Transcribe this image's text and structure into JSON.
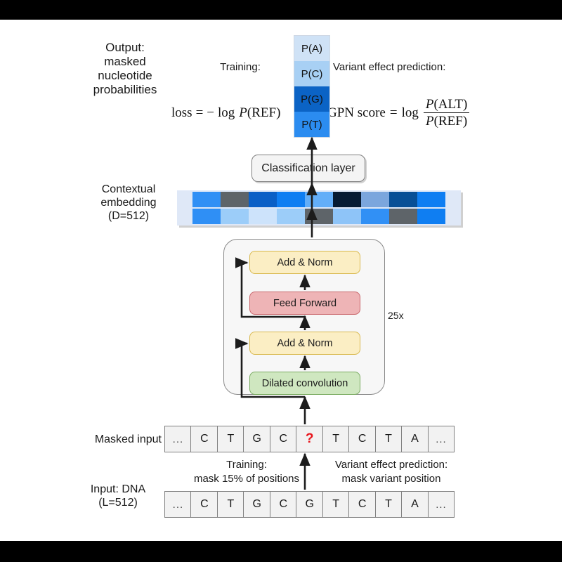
{
  "figure": {
    "left_labels": {
      "output": "Output:\nmasked\nnucleotide\nprobabilities",
      "contextual_embedding": "Contextual\nembedding\n(D=512)",
      "masked_input": "Masked input",
      "input_dna": "Input: DNA\n(L=512)"
    },
    "top_section": {
      "training_heading": "Training:",
      "loss_formula": "loss = − log P(REF)",
      "loss_parts": {
        "lhs": "loss",
        "eq": "=",
        "minus": "−",
        "log": "log",
        "p_italic": "P",
        "ref_arg": "(REF)"
      },
      "variant_heading": "Variant effect prediction:",
      "gpn_formula": "GPN score = log P(ALT)/P(REF)",
      "gpn_parts": {
        "lhs": "GPN score",
        "eq": "=",
        "log": "log",
        "numerator_p": "P",
        "numerator_arg": "(ALT)",
        "denominator_p": "P",
        "denominator_arg": "(REF)"
      }
    },
    "probability_column": {
      "name": "masked-nucleotide-probabilities",
      "cells": [
        {
          "label": "P(A)",
          "color": "#cfe2f6"
        },
        {
          "label": "P(C)",
          "color": "#a8d0f4"
        },
        {
          "label": "P(G)",
          "color": "#0b63c5"
        },
        {
          "label": "P(T)",
          "color": "#2b8cf0"
        }
      ]
    },
    "classification_layer": {
      "label": "Classification layer"
    },
    "embedding_strip": {
      "pad_color": "#dfe8f7",
      "row_top": [
        "#3190f5",
        "#5e6469",
        "#0a5fc6",
        "#0f7ef2",
        "#63aef8",
        "#061b33",
        "#7ba6dd",
        "#084f96",
        "#0f7ef2"
      ],
      "row_bottom": [
        "#2f8ff5",
        "#9ccdf9",
        "#cde3fb",
        "#9ccdf9",
        "#5e6469",
        "#8ec4f8",
        "#3190f5",
        "#5e6469",
        "#0f7ef2"
      ]
    },
    "transformer_block": {
      "repeat_label": "25x",
      "layers": [
        {
          "name": "add-norm-top",
          "label": "Add & Norm",
          "style": "ln"
        },
        {
          "name": "feed-forward",
          "label": "Feed Forward",
          "style": "ff"
        },
        {
          "name": "add-norm-bottom",
          "label": "Add & Norm",
          "style": "ln"
        },
        {
          "name": "dilated-convolution",
          "label": "Dilated convolution",
          "style": "dc"
        }
      ]
    },
    "middle_annotations": {
      "training_heading": "Training:",
      "training_detail": "mask 15% of positions",
      "variant_heading": "Variant effect prediction:",
      "variant_detail": "mask variant position"
    },
    "sequences": {
      "masked_input": [
        "...",
        "C",
        "T",
        "G",
        "C",
        "?",
        "T",
        "C",
        "T",
        "A",
        "..."
      ],
      "masked_index": 5,
      "input_dna": [
        "...",
        "C",
        "T",
        "G",
        "C",
        "G",
        "T",
        "C",
        "T",
        "A",
        "..."
      ]
    },
    "colors": {
      "background": "#ffffff",
      "band": "#000000",
      "masked_token": "#e8141b",
      "layernorm": "#fbeec4",
      "feedforward": "#eeb4b6",
      "convolution": "#cfe7c0"
    }
  }
}
